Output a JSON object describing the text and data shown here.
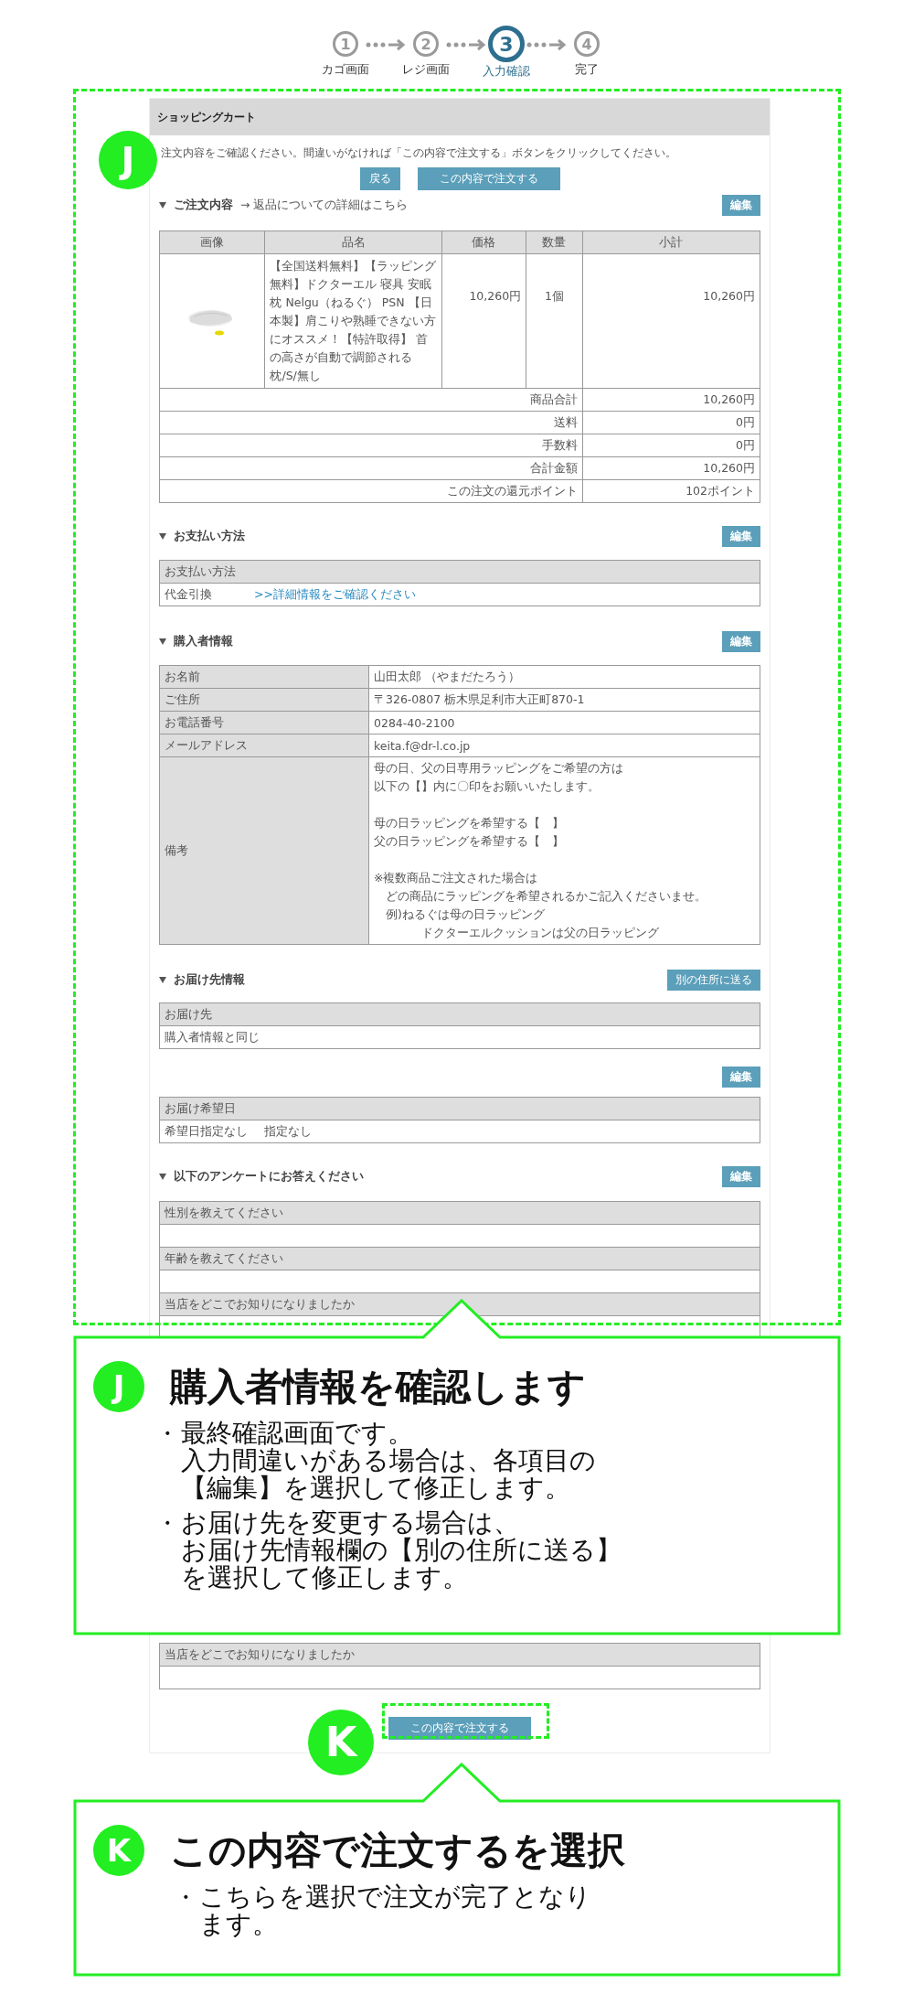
{
  "steps": [
    {
      "number": "1",
      "label": "カゴ画面",
      "selected": false
    },
    {
      "number": "2",
      "label": "レジ画面",
      "selected": false
    },
    {
      "number": "3",
      "label": "入力確認",
      "selected": true
    },
    {
      "number": "4",
      "label": "完了",
      "selected": false
    }
  ],
  "cart": {
    "title": "ショッピングカート",
    "notice": "注文内容をご確認ください。間違いがなければ「この内容で注文する」ボタンをクリックしてください。",
    "buttons": [
      "戻る",
      "この内容で注文する"
    ],
    "order": {
      "heading": "ご注文内容",
      "link": "→ 返品についての詳細はこちら",
      "edit": "編集",
      "columns": [
        "画像",
        "品名",
        "価格",
        "数量",
        "小計"
      ],
      "items": [
        {
          "name": "【全国送料無料】【ラッピング無料】ドクターエル 寝具 安眠枕 Nelgu（ねるぐ） PSN 【日本製】肩こりや熟睡できない方にオススメ！【特許取得】 首の高さが自動で調節される枕/S/無し",
          "price": "10,260円",
          "qty": "1個",
          "subtotal": "10,260円"
        }
      ],
      "summary": [
        {
          "label": "商品合計",
          "value": "10,260円"
        },
        {
          "label": "送料",
          "value": "0円"
        },
        {
          "label": "手数料",
          "value": "0円"
        },
        {
          "label": "合計金額",
          "value": "10,260円"
        },
        {
          "label": "この注文の還元ポイント",
          "value": "102ポイント"
        }
      ]
    },
    "payment": {
      "heading": "お支払い方法",
      "edit": "編集",
      "table_header": "お支払い方法",
      "method": "代金引換",
      "link": ">>詳細情報をご確認ください"
    },
    "buyer": {
      "heading": "購入者情報",
      "edit": "編集",
      "rows": [
        {
          "label": "お名前",
          "value": "山田太郎 （やまだたろう）"
        },
        {
          "label": "ご住所",
          "value": "〒326-0807  栃木県足利市大正町870-1"
        },
        {
          "label": "お電話番号",
          "value": "0284-40-2100"
        },
        {
          "label": "メールアドレス",
          "value": "keita.f@dr-l.co.jp"
        },
        {
          "label": "備考",
          "paragraphs": [
            [
              "母の日、父の日専用ラッピングをご希望の方は",
              "以下の【】内に〇印をお願いいたします。"
            ],
            [
              "母の日ラッピングを希望する【　】",
              "父の日ラッピングを希望する【　】"
            ],
            [
              "※複数商品ご注文された場合は",
              "　どの商品にラッピングを希望されるかご記入くださいませ。",
              "　例)ねるぐは母の日ラッピング",
              "　　　　ドクターエルクッションは父の日ラッピング"
            ]
          ]
        }
      ]
    },
    "delivery": {
      "heading": "お届け先情報",
      "button": "別の住所に送る",
      "table_header": "お届け先",
      "value": "購入者情報と同じ"
    },
    "delivery_date": {
      "edit": "編集",
      "table_header": "お届け希望日",
      "values": [
        "希望日指定なし",
        "指定なし"
      ]
    },
    "survey": {
      "heading": "以下のアンケートにお答えください",
      "edit": "編集",
      "questions": [
        "性別を教えてください",
        "年齢を教えてください",
        "当店をどこでお知りになりましたか"
      ]
    },
    "survey_tail": {
      "question": "当店をどこでお知りになりましたか"
    },
    "submit": "この内容で注文する"
  },
  "markers": [
    {
      "badge": "J"
    },
    {
      "badge": "K"
    }
  ],
  "callouts": [
    {
      "badge": "J",
      "title": "購入者情報を確認します",
      "bullet": "・",
      "bullets": [
        [
          "最終確認画面です。",
          "入力間違いがある場合は、各項目の",
          "【編集】を選択して修正します。"
        ],
        [
          "お届け先を変更する場合は、",
          "お届け先情報欄の【別の住所に送る】",
          "を選択して修正します。"
        ]
      ]
    },
    {
      "badge": "K",
      "title": "この内容で注文するを選択",
      "bullet": "・",
      "bullets": [
        [
          "こちらを選択で注文が完了となり",
          "ます。"
        ]
      ]
    }
  ]
}
